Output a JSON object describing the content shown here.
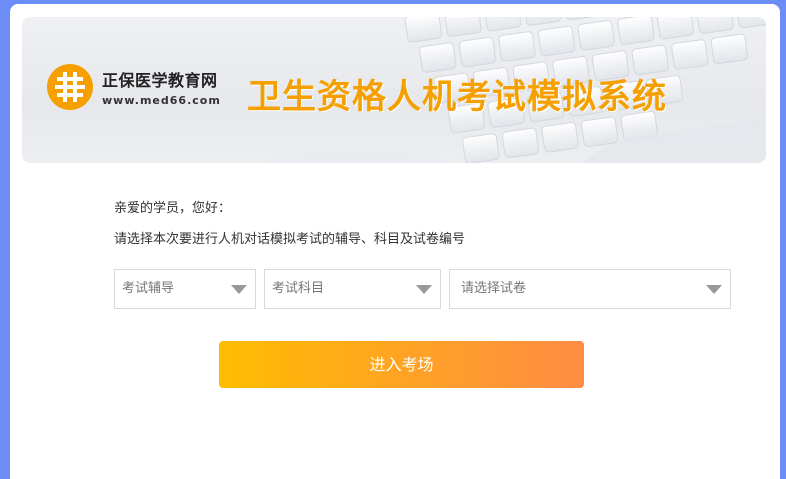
{
  "banner": {
    "logo_brand": "正保",
    "logo_name": "医学教育网",
    "logo_url": "www.med66.com",
    "title": "卫生资格人机考试模拟系统",
    "accent_color": "#f5a000"
  },
  "greeting": "亲爱的学员，您好：",
  "instruction": "请选择本次要进行人机对话模拟考试的辅导、科目及试卷编号",
  "selects": {
    "coaching": {
      "placeholder": "考试辅导"
    },
    "subject": {
      "placeholder": "考试科目"
    },
    "paper": {
      "placeholder": "请选择试卷"
    }
  },
  "enter_button": {
    "label": "进入考场",
    "color_start": "#ffbd00",
    "color_end": "#ff8c45"
  },
  "icons": [
    "logo-mark-icon",
    "chevron-down-icon"
  ]
}
